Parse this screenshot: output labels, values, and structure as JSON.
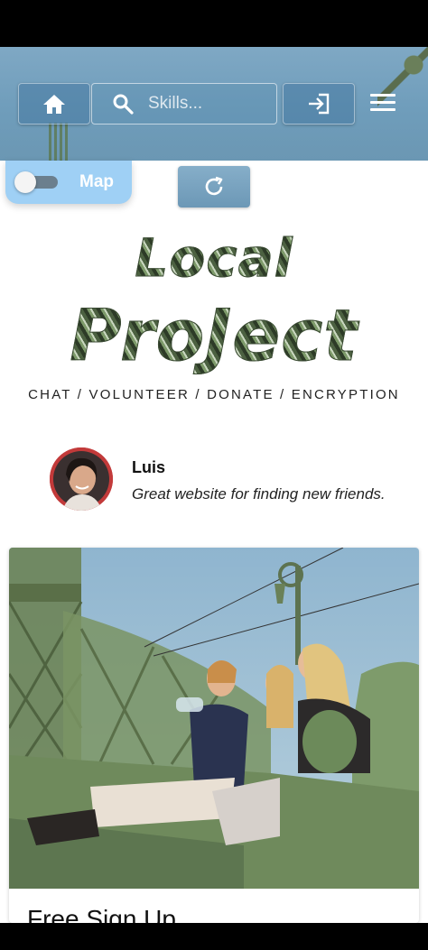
{
  "header": {
    "search": {
      "placeholder": "Skills..."
    },
    "icons": {
      "home": "home-icon",
      "search": "search-icon",
      "login": "login-icon",
      "menu": "menu-icon"
    }
  },
  "map_toggle": {
    "label": "Map",
    "checked": false
  },
  "refresh": {
    "icon": "refresh-icon"
  },
  "hero": {
    "title_line1": "Local",
    "title_line2": "ProJect",
    "tagline": "CHAT / VOLUNTEER / DONATE / ENCRYPTION"
  },
  "testimonial": {
    "name": "Luis",
    "quote": "Great website for finding new friends."
  },
  "card": {
    "title": "Free Sign Up"
  },
  "colors": {
    "header_blue": "#7fa8c4",
    "toggle_bg": "#9fd0f5",
    "title_green": "#4c6141"
  }
}
